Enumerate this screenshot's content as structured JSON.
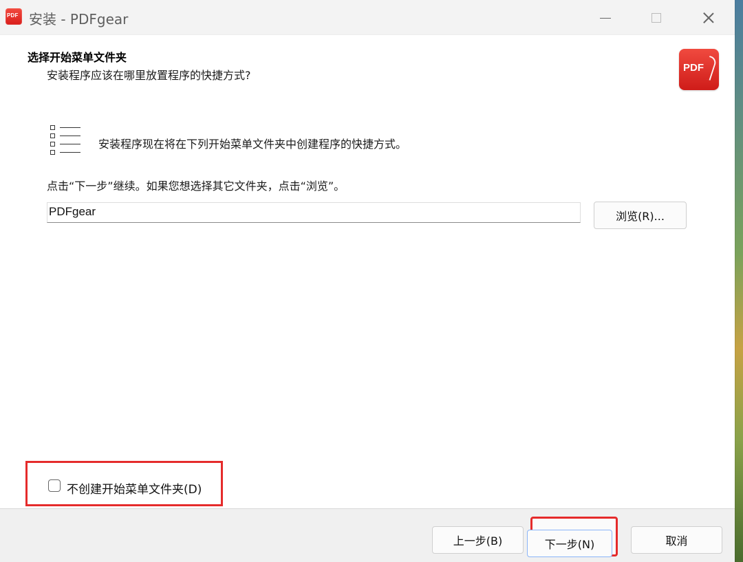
{
  "window": {
    "title": "安装 - PDFgear",
    "app_icon_text": "PDF"
  },
  "header": {
    "title": "选择开始菜单文件夹",
    "subtitle": "安装程序应该在哪里放置程序的快捷方式?",
    "logo_text": "PDF"
  },
  "body": {
    "description": "安装程序现在将在下列开始菜单文件夹中创建程序的快捷方式。",
    "instruction": "点击“下一步”继续。如果您想选择其它文件夹，点击“浏览”。",
    "folder_name": "PDFgear",
    "browse_label": "浏览(R)..."
  },
  "options": {
    "no_start_menu_label": "不创建开始菜单文件夹(D)",
    "no_start_menu_checked": false
  },
  "footer": {
    "back_label": "上一步(B)",
    "next_label": "下一步(N)",
    "cancel_label": "取消"
  },
  "colors": {
    "highlight": "#e52b2b",
    "brand": "#d91e1b"
  },
  "icons": {
    "list": "list-icon",
    "minimize": "minimize-icon",
    "maximize": "maximize-icon",
    "close": "close-icon"
  }
}
